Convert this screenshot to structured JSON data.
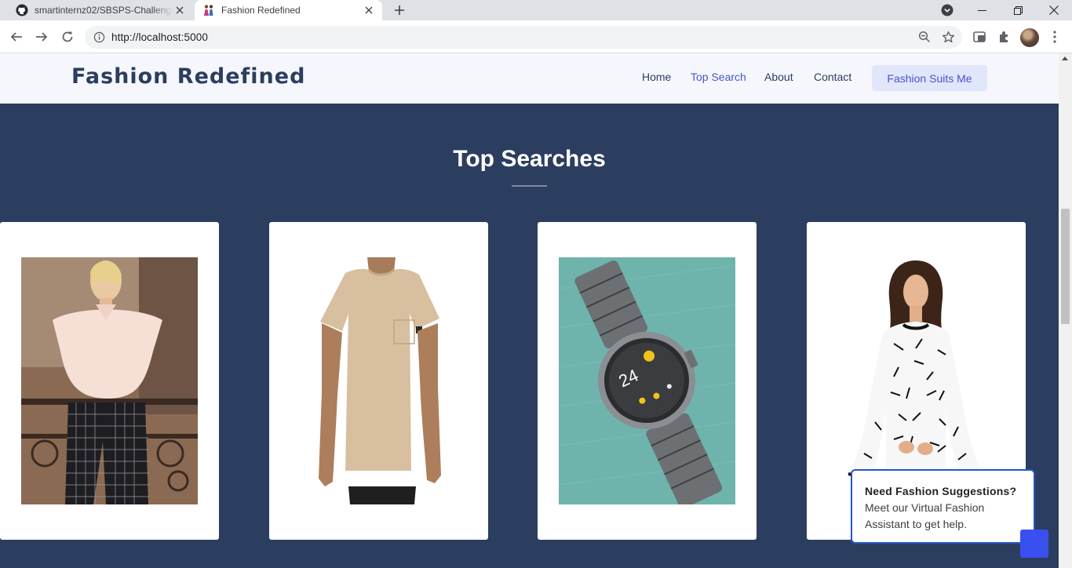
{
  "browser": {
    "tabs": [
      {
        "title": "smartinternz02/SBSPS-Challenge",
        "icon": "github-icon",
        "active": false
      },
      {
        "title": "Fashion Redefined",
        "icon": "fashion-favicon",
        "active": true
      }
    ],
    "url": "http://localhost:5000"
  },
  "site": {
    "logo": "Fashion Redefined",
    "nav": {
      "home": "Home",
      "top_search": "Top Search",
      "about": "About",
      "contact": "Contact",
      "cta": "Fashion Suits Me"
    },
    "section_title": "Top Searches",
    "cards": [
      {
        "image": "off-shoulder blouse with plaid pants"
      },
      {
        "image": "beige pocket t-shirt"
      },
      {
        "image": "silver smartwatch"
      },
      {
        "image": "printed bell-sleeve top"
      }
    ]
  },
  "chat": {
    "heading": "Need Fashion Suggestions?",
    "body": "Meet our Virtual Fashion Assistant to get help."
  },
  "colors": {
    "page_bg": "#2c3e5f",
    "header_bg": "#f5f7fd",
    "accent": "#4656c8",
    "chat_border": "#2356c4",
    "chat_fab": "#3a4ff0"
  }
}
